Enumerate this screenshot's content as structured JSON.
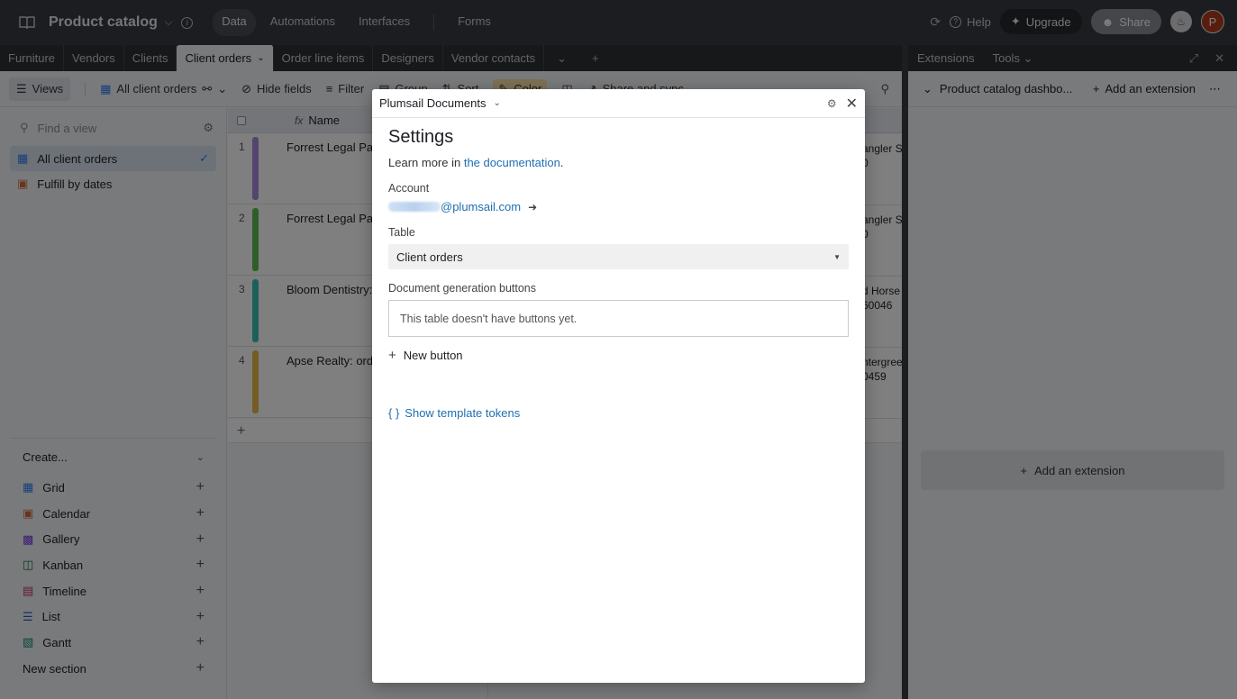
{
  "topbar": {
    "title": "Product catalog",
    "nav": [
      "Data",
      "Automations",
      "Interfaces",
      "Forms"
    ],
    "help": "Help",
    "upgrade": "Upgrade",
    "share": "Share",
    "avatar_initial": "P"
  },
  "tabs": [
    "Furniture",
    "Vendors",
    "Clients",
    "Client orders",
    "Order line items",
    "Designers",
    "Vendor contacts"
  ],
  "extensions_header": {
    "extensions": "Extensions",
    "tools": "Tools"
  },
  "viewbar": {
    "views": "Views",
    "current_view": "All client orders",
    "hide_fields": "Hide fields",
    "filter": "Filter",
    "group": "Group",
    "sort": "Sort",
    "color": "Color",
    "share_sync": "Share and sync"
  },
  "sidebar": {
    "find_placeholder": "Find a view",
    "views": [
      {
        "label": "All client orders",
        "active": true
      },
      {
        "label": "Fulfill by dates",
        "active": false
      }
    ],
    "create_label": "Create...",
    "create_items": [
      "Grid",
      "Calendar",
      "Gallery",
      "Kanban",
      "Timeline",
      "List",
      "Gantt",
      "New section"
    ]
  },
  "grid": {
    "column_name": "Name",
    "rows": [
      {
        "num": "1",
        "name": "Forrest Legal Partners",
        "right": "angler S",
        "right2": "0",
        "color": "#a68ae0"
      },
      {
        "num": "2",
        "name": "Forrest Legal Partners",
        "right": "angler S",
        "right2": "0",
        "color": "#5fbd55"
      },
      {
        "num": "3",
        "name": "Bloom Dentistry: o",
        "right": "d Horse",
        "right2": "60046",
        "color": "#3cc0b3"
      },
      {
        "num": "4",
        "name": "Apse Realty: order",
        "right": "ntergree",
        "right2": "0459",
        "color": "#e8b94a"
      }
    ]
  },
  "extensions_panel": {
    "dashboard_name": "Product catalog dashbo...",
    "add_extension": "Add an extension",
    "add_extension_box": "Add an extension"
  },
  "modal": {
    "app_name": "Plumsail Documents",
    "title": "Settings",
    "learn_prefix": "Learn more in ",
    "learn_link": "the documentation",
    "learn_suffix": ".",
    "account_label": "Account",
    "account_email_domain": "@plumsail.com",
    "table_label": "Table",
    "table_value": "Client orders",
    "buttons_label": "Document generation buttons",
    "buttons_empty": "This table doesn't have buttons yet.",
    "new_button": "New button",
    "show_tokens": "Show template tokens"
  },
  "colors": {
    "topbar": "#383a40",
    "accent_link": "#1f6fb2",
    "avatar": "#b33a1b"
  }
}
